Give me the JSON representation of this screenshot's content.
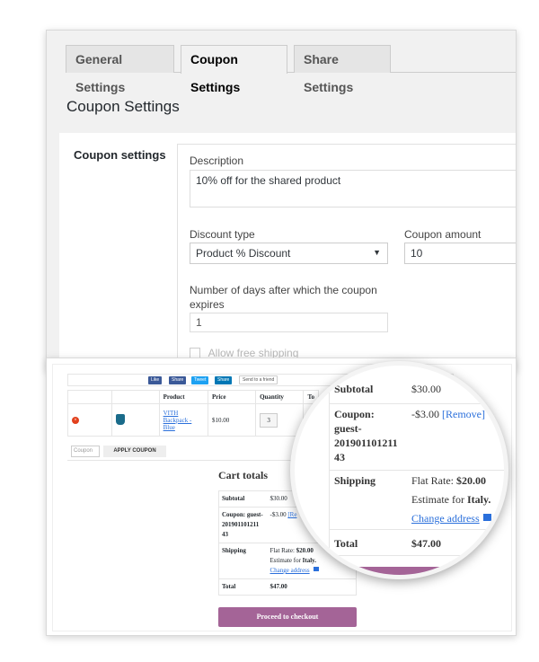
{
  "settings": {
    "tabs": [
      {
        "label": "General Settings"
      },
      {
        "label": "Coupon Settings"
      },
      {
        "label": "Share Settings"
      }
    ],
    "heading": "Coupon Settings",
    "row_label": "Coupon settings",
    "description_label": "Description",
    "description_value": "10% off for the shared product",
    "discount_type_label": "Discount type",
    "discount_type_value": "Product % Discount",
    "coupon_amount_label": "Coupon amount",
    "coupon_amount_value": "10",
    "days_label": "Number of days after which the coupon expires",
    "days_value": "1",
    "free_shipping_label": "Allow free shipping"
  },
  "cart": {
    "share_buttons": [
      "Like",
      "Share",
      "Tweet",
      "Share",
      "Send to a friend"
    ],
    "columns": [
      "",
      "",
      "Product",
      "Price",
      "Quantity",
      "To"
    ],
    "item": {
      "product": "VITH Backpack - Blue",
      "price": "$10.00",
      "quantity": "3"
    },
    "coupon_placeholder": "Coupon",
    "apply_label": "APPLY COUPON",
    "totals_title": "Cart totals",
    "subtotal_label": "Subtotal",
    "subtotal_value": "$30.00",
    "coupon_label": "Coupon: guest-201901101211 43",
    "coupon_value": "-$3.00",
    "remove_label": "[Re",
    "shipping_label": "Shipping",
    "shipping_rate_prefix": "Flat Rate:",
    "shipping_rate": "$20.00",
    "estimate_prefix": "Estimate for",
    "estimate_country": "Italy.",
    "change_address": "Change address",
    "total_label": "Total",
    "total_value": "$47.00",
    "checkout_label": "Proceed to checkout"
  },
  "magnifier": {
    "subtotal_label": "Subtotal",
    "subtotal_value": "$30.00",
    "coupon_label_1": "Coupon:",
    "coupon_label_2": "guest-",
    "coupon_label_3": "201901101211",
    "coupon_label_4": "43",
    "coupon_value": "-$3.00",
    "remove_label": "[Remove]",
    "shipping_label": "Shipping",
    "shipping_rate_prefix": "Flat Rate:",
    "shipping_rate": "$20.00",
    "estimate_prefix": "Estimate for",
    "estimate_country": "Italy.",
    "change_address": "Change address",
    "total_label": "Total",
    "total_value": "$47.00"
  },
  "colors": {
    "accent": "#a46497",
    "link": "#2a6fdb",
    "facebook": "#3b5998",
    "twitter": "#1da1f2",
    "linkedin": "#0077b5"
  }
}
